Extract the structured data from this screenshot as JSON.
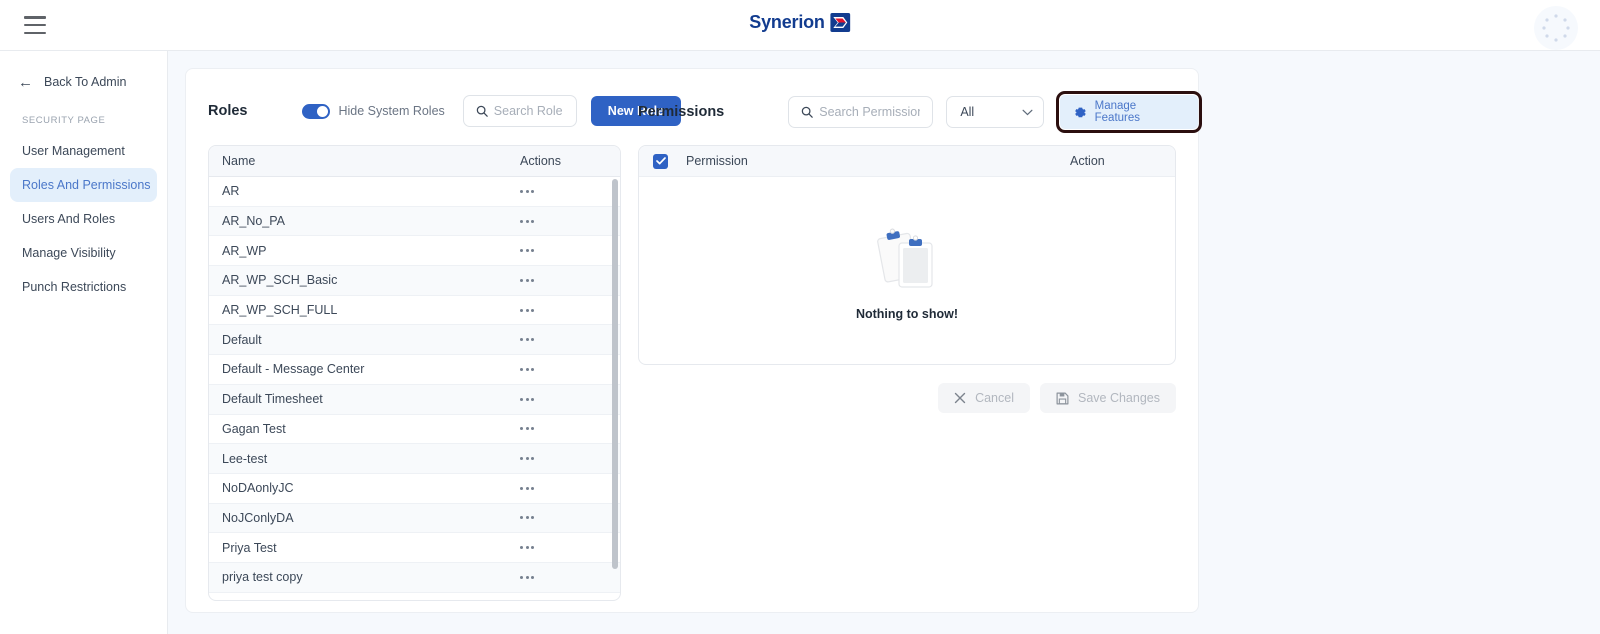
{
  "topbar": {
    "menu_icon": "hamburger-menu-icon",
    "brand_text": "Synerion",
    "brand_mark": "synerion-logo-mark",
    "avatar": "user-avatar-placeholder"
  },
  "sidebar": {
    "back_label": "Back To Admin",
    "back_icon": "arrow-left-icon",
    "section_label": "SECURITY PAGE",
    "items": [
      {
        "label": "User Management",
        "active": false
      },
      {
        "label": "Roles And Permissions",
        "active": true
      },
      {
        "label": "Users And Roles",
        "active": false
      },
      {
        "label": "Manage Visibility",
        "active": false
      },
      {
        "label": "Punch Restrictions",
        "active": false
      }
    ]
  },
  "roles": {
    "title": "Roles",
    "toggle_label": "Hide System Roles",
    "toggle_on": true,
    "search_placeholder": "Search Role",
    "search_value": "",
    "new_role_label": "New Role",
    "columns": {
      "name": "Name",
      "actions": "Actions"
    },
    "rows": [
      {
        "name": "AR"
      },
      {
        "name": "AR_No_PA"
      },
      {
        "name": "AR_WP"
      },
      {
        "name": "AR_WP_SCH_Basic"
      },
      {
        "name": "AR_WP_SCH_FULL"
      },
      {
        "name": "Default"
      },
      {
        "name": "Default - Message Center"
      },
      {
        "name": "Default Timesheet"
      },
      {
        "name": "Gagan Test"
      },
      {
        "name": "Lee-test"
      },
      {
        "name": "NoDAonlyJC"
      },
      {
        "name": "NoJConlyDA"
      },
      {
        "name": "Priya Test"
      },
      {
        "name": "priya test copy"
      }
    ]
  },
  "permissions": {
    "title": "Permissions",
    "search_placeholder": "Search Permission",
    "search_value": "",
    "filter_selected": "All",
    "manage_features_label": "Manage Features",
    "columns": {
      "permission": "Permission",
      "action": "Action"
    },
    "header_checkbox_checked": true,
    "empty_text": "Nothing to show!",
    "empty_illustration": "clipboards-icon",
    "cancel_label": "Cancel",
    "save_label": "Save Changes",
    "cancel_enabled": false,
    "save_enabled": false
  },
  "colors": {
    "accent": "#2f62c4",
    "accent_soft": "#e3effb",
    "page_bg": "#f6f9fd",
    "brand_navy": "#123c8f",
    "brand_red": "#e1142d",
    "focus_outline": "#2b0f0f"
  }
}
